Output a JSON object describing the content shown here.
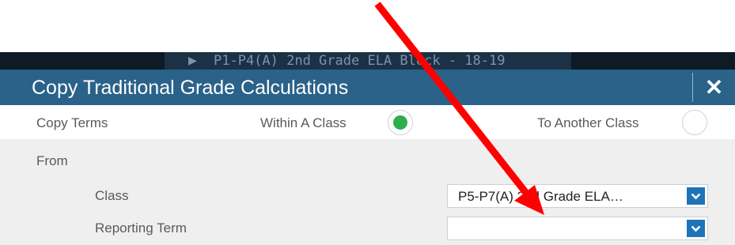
{
  "background": {
    "class_tab": {
      "icon": "play-triangle-icon",
      "text": "P1-P4(A) 2nd Grade ELA Block  - 18-19"
    }
  },
  "dialog": {
    "title": "Copy Traditional Grade Calculations",
    "close_label": "✕",
    "copy_terms": {
      "label": "Copy Terms",
      "within_label": "Within A Class",
      "another_label": "To Another Class",
      "selected": "within"
    },
    "from": {
      "label": "From",
      "class_label": "Class",
      "class_value": "P5-P7(A) 2nd Grade ELA…",
      "term_label": "Reporting Term",
      "term_value": ""
    }
  },
  "colors": {
    "title_bar": "#2a6289",
    "radio_selected": "#2fae4e",
    "select_chevron": "#1f74b8",
    "annotation_arrow": "#ff0000"
  }
}
